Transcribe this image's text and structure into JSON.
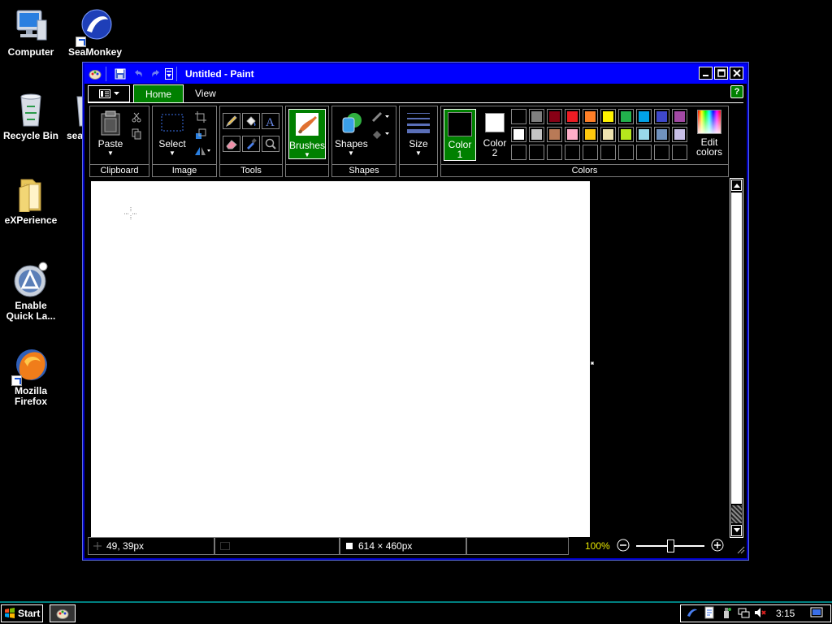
{
  "desktop": {
    "icons": [
      {
        "label": "Computer",
        "icon": "computer-icon"
      },
      {
        "label": "SeaMonkey",
        "icon": "seamonkey-icon"
      },
      {
        "label": "Recycle Bin",
        "icon": "recycle-bin-icon"
      },
      {
        "label": "sea",
        "icon": "seamonkey-icon"
      },
      {
        "label": "eXPerience",
        "icon": "folder-icon"
      },
      {
        "label": "Enable Quick La...",
        "icon": "quicklaunch-icon"
      },
      {
        "label": "Mozilla Firefox",
        "icon": "firefox-icon"
      }
    ]
  },
  "window": {
    "title": "Untitled - Paint",
    "quick_access": [
      "paint-app-icon",
      "save-icon",
      "undo-icon",
      "redo-icon",
      "customize-dropdown-icon"
    ],
    "controls": {
      "minimize": "_",
      "maximize": "□",
      "close": "✕"
    }
  },
  "ribbon": {
    "tabs": [
      {
        "label": "Home",
        "active": true
      },
      {
        "label": "View",
        "active": false
      }
    ],
    "help_label": "?",
    "groups": {
      "clipboard": {
        "label": "Clipboard",
        "paste": "Paste"
      },
      "image": {
        "label": "Image",
        "select": "Select"
      },
      "tools": {
        "label": "Tools"
      },
      "brushes": {
        "label": "Brushes"
      },
      "shapes": {
        "label": "Shapes",
        "shapes_btn": "Shapes"
      },
      "size": {
        "label": "Size"
      },
      "colors": {
        "label": "Colors",
        "color1_line1": "Color",
        "color1_line2": "1",
        "color2_line1": "Color",
        "color2_line2": "2",
        "edit_line1": "Edit",
        "edit_line2": "colors",
        "color1_value": "#000000",
        "color2_value": "#ffffff",
        "palette_row1": [
          "#000000",
          "#7f7f7f",
          "#880015",
          "#ed1c24",
          "#ff7f27",
          "#fff200",
          "#22b14c",
          "#00a2e8",
          "#3f48cc",
          "#a349a4"
        ],
        "palette_row2": [
          "#ffffff",
          "#c3c3c3",
          "#b97a57",
          "#ffaec9",
          "#ffc90e",
          "#efe4b0",
          "#b5e61d",
          "#99d9ea",
          "#7092be",
          "#c8bfe7"
        ],
        "palette_row3": [
          "",
          "",
          "",
          "",
          "",
          "",
          "",
          "",
          "",
          ""
        ]
      }
    }
  },
  "status": {
    "cursor_pos": "49, 39px",
    "selection_size": "",
    "canvas_size": "614 × 460px",
    "zoom": "100%",
    "zoom_level_fraction": 0.5
  },
  "taskbar": {
    "start_label": "Start",
    "clock": "3:15",
    "accent": "#008080"
  },
  "colors": {
    "titlebar": "#0000ff",
    "active_tab": "#008000",
    "background": "#000000"
  }
}
